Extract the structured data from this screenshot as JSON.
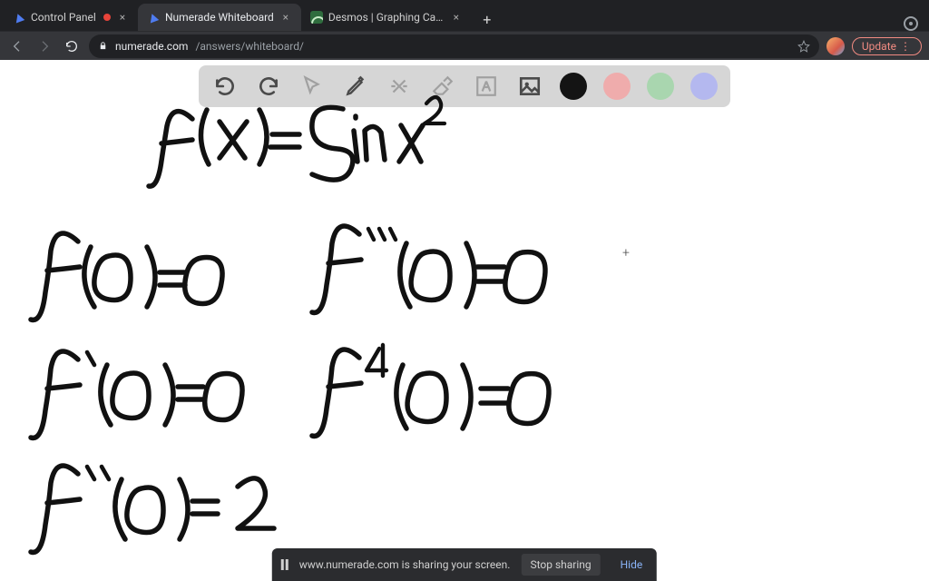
{
  "browser": {
    "tabs": [
      {
        "title": "Control Panel",
        "active": false,
        "recording": true
      },
      {
        "title": "Numerade Whiteboard",
        "active": true,
        "recording": false
      },
      {
        "title": "Desmos | Graphing Calculator",
        "active": false,
        "recording": false
      }
    ],
    "new_tab_glyph": "+",
    "close_glyph": "×",
    "url_host": "numerade.com",
    "url_path": "/answers/whiteboard/",
    "update_label": "Update",
    "update_menu_glyph": "⋮"
  },
  "toolbar": {
    "items": [
      {
        "name": "undo-button",
        "interactable": true
      },
      {
        "name": "redo-button",
        "interactable": true
      },
      {
        "name": "pointer-tool-button",
        "interactable": true,
        "dim": true
      },
      {
        "name": "pen-tool-button",
        "interactable": true
      },
      {
        "name": "tools-button",
        "interactable": true,
        "dim": true
      },
      {
        "name": "eraser-tool-button",
        "interactable": true,
        "dim": true
      },
      {
        "name": "text-tool-button",
        "interactable": true,
        "dim": true
      },
      {
        "name": "image-tool-button",
        "interactable": true
      }
    ],
    "colors": {
      "black": "#141414",
      "red": "#efacac",
      "green": "#a9d6af",
      "blue": "#b4b8ef",
      "selected": "black"
    }
  },
  "handwriting": {
    "lines": [
      "f(x) = sin x^2",
      "f(0) = 0",
      "f'(0) = 0",
      "f''(0) = 2",
      "f'''(0) = 0",
      "f^4(0) = 0"
    ],
    "cursor_glyph": "+"
  },
  "share_bar": {
    "message": "www.numerade.com is sharing your screen.",
    "stop_label": "Stop sharing",
    "hide_label": "Hide"
  }
}
